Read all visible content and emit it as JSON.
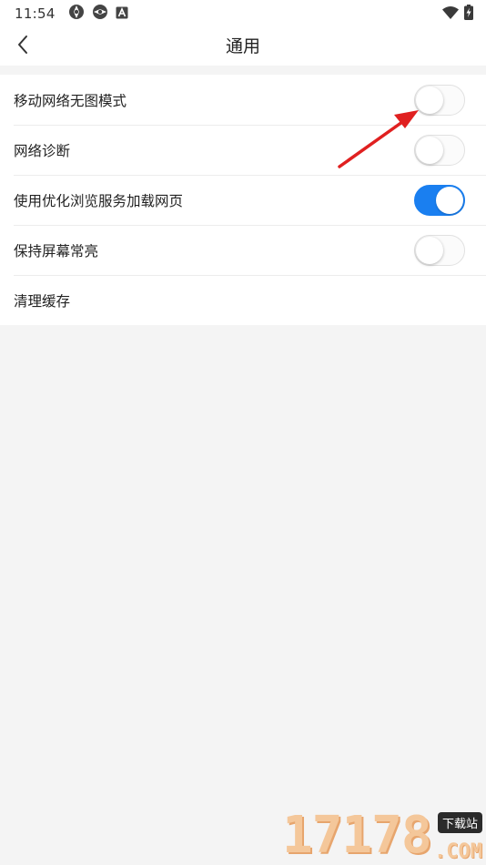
{
  "status_bar": {
    "time": "11:54",
    "left_icons": [
      "aperture-icon",
      "aperture-icon",
      "text-a-icon"
    ],
    "right_icons": [
      "wifi-icon",
      "battery-charging-icon"
    ]
  },
  "header": {
    "back_icon": "chevron-left-icon",
    "title": "通用"
  },
  "settings": [
    {
      "label": "移动网络无图模式",
      "toggle": false
    },
    {
      "label": "网络诊断",
      "toggle": false
    },
    {
      "label": "使用优化浏览服务加载网页",
      "toggle": true
    },
    {
      "label": "保持屏幕常亮",
      "toggle": false
    },
    {
      "label": "清理缓存",
      "toggle": null
    }
  ],
  "annotation": {
    "arrow_color": "#e02020"
  },
  "watermark": {
    "digits": "17178",
    "badge": "下载站",
    "suffix": ".COM"
  },
  "colors": {
    "toggle_on": "#1a7ff0",
    "background": "#f4f4f4",
    "surface": "#ffffff"
  }
}
